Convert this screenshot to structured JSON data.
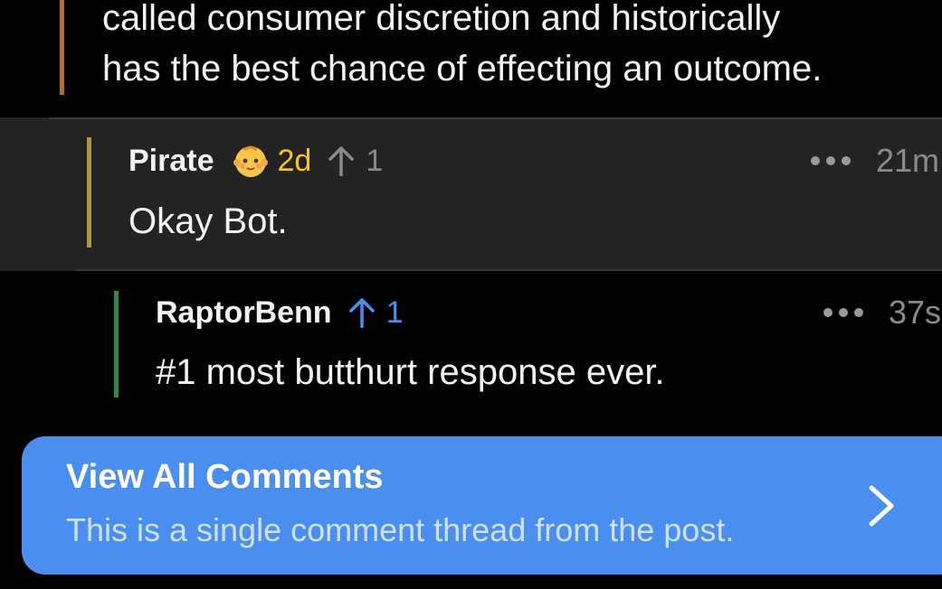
{
  "parent_comment": {
    "body_lines": "called consumer discretion and historically\nhas the best chance of effecting an outcome.",
    "thread_color": "#b86a36"
  },
  "comments": [
    {
      "author": "Pirate",
      "badge_icon": "baby-face-icon",
      "badge_text": "2d",
      "score": "1",
      "vote_state": "neutral",
      "more_icon": "ellipsis-icon",
      "time": "21m",
      "body": "Okay Bot.",
      "thread_color": "#b3953a",
      "highlighted": true
    },
    {
      "author": "RaptorBenn",
      "score": "1",
      "vote_state": "upvoted",
      "more_icon": "ellipsis-icon",
      "time": "37s",
      "body": "#1 most butthurt response ever.",
      "thread_color": "#2e8a45",
      "highlighted": false
    }
  ],
  "view_all": {
    "title": "View All Comments",
    "subtitle": "This is a single comment thread from the post.",
    "icon": "chevron-right-icon",
    "color": "#4a8ff0"
  },
  "colors": {
    "background": "#000000",
    "highlight_background": "#232323",
    "upvote": "#4a8ff0",
    "cake_day": "#f5c518",
    "muted": "#8a8a8a"
  }
}
